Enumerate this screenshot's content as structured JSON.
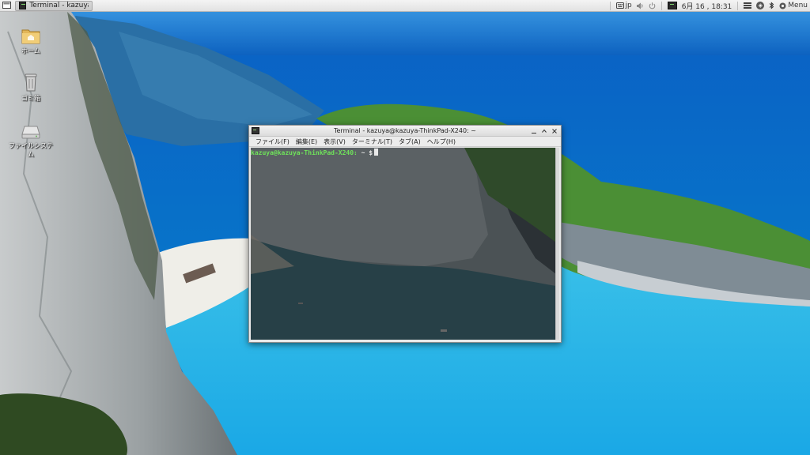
{
  "panel": {
    "task_title": "Terminal - kazuya@k...",
    "keyboard_layout": "jp",
    "clock": "6月 16 , 18:31",
    "menu_label": "Menu"
  },
  "desktop": {
    "icons": [
      {
        "label": "ホーム",
        "icon": "home-folder-icon"
      },
      {
        "label": "ゴミ箱",
        "icon": "trash-icon"
      },
      {
        "label": "ファイルシステム",
        "icon": "filesystem-drive-icon"
      }
    ]
  },
  "terminal": {
    "title": "Terminal - kazuya@kazuya-ThinkPad-X240: ~",
    "menu": [
      "ファイル(F)",
      "編集(E)",
      "表示(V)",
      "ターミナル(T)",
      "タブ(A)",
      "ヘルプ(H)"
    ],
    "prompt_user": "kazuya@kazuya-ThinkPad-X240:",
    "prompt_path": " ~ $",
    "colors": {
      "prompt": "#6fe35a",
      "text": "#e8e8e8"
    }
  }
}
